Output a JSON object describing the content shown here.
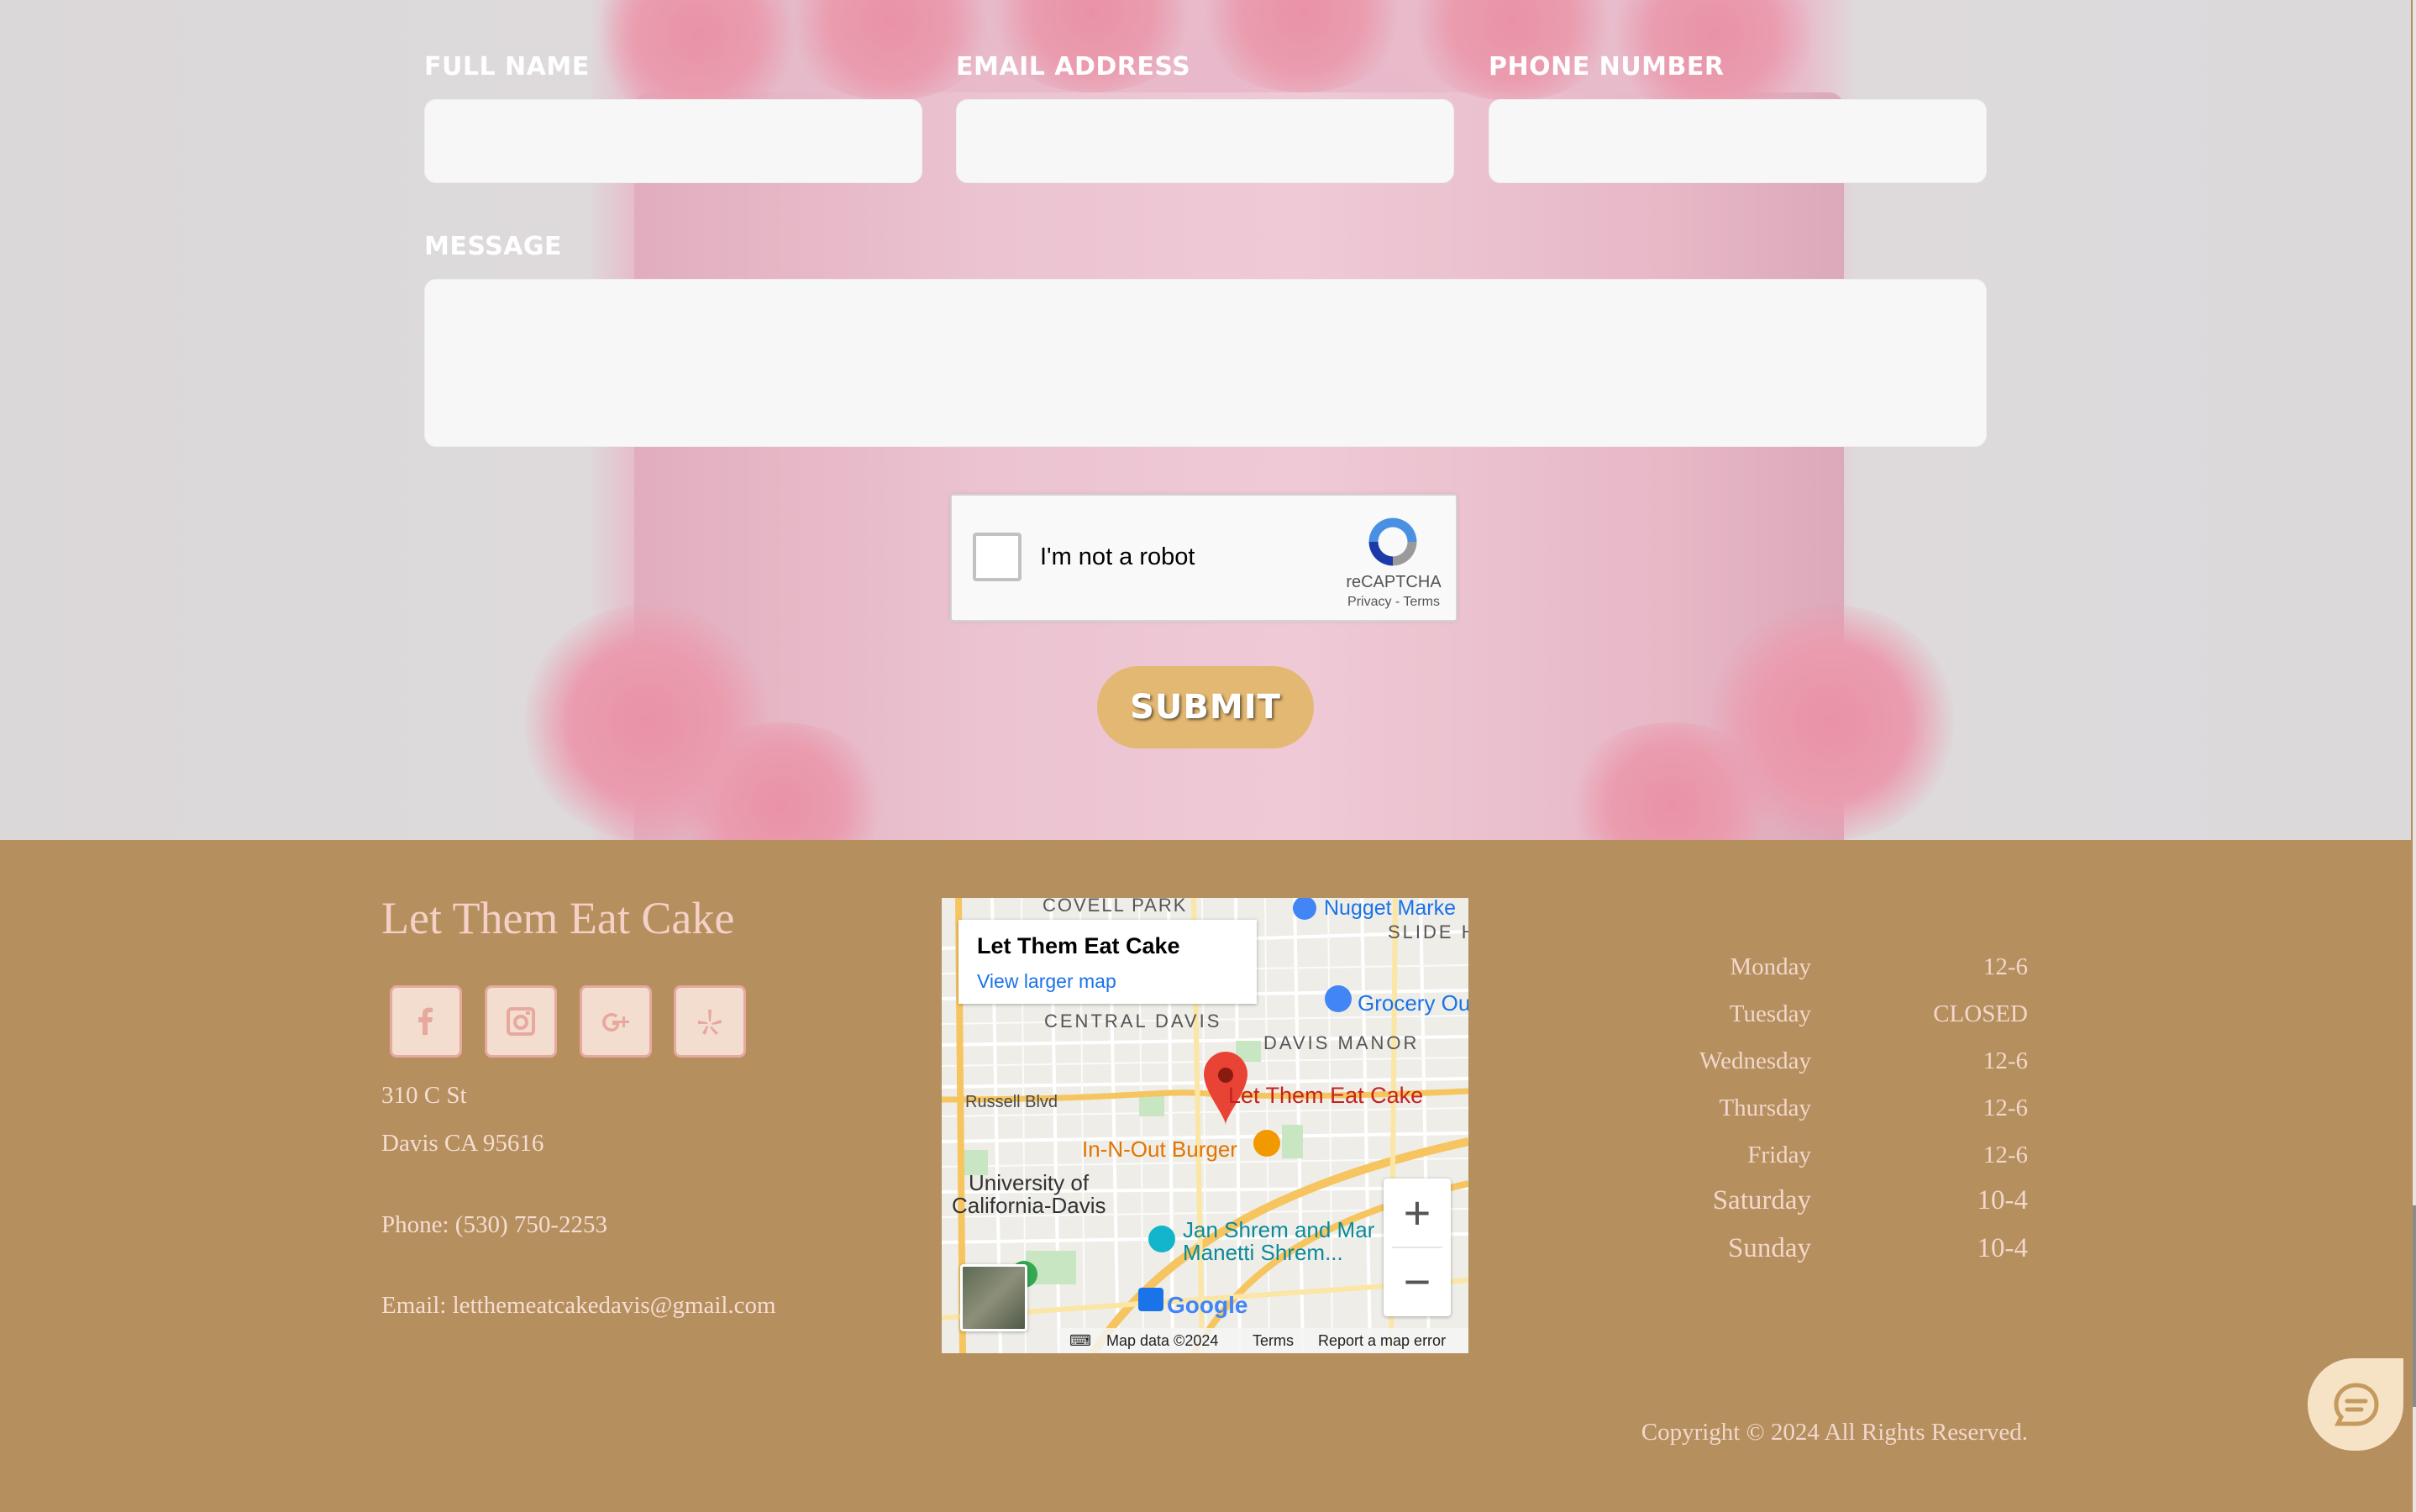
{
  "form": {
    "full_name_label": "FULL NAME",
    "email_label": "EMAIL ADDRESS",
    "phone_label": "PHONE NUMBER",
    "message_label": "MESSAGE",
    "full_name_value": "",
    "email_value": "",
    "phone_value": "",
    "message_value": "",
    "recaptcha_label": "I'm not a robot",
    "recaptcha_brand": "reCAPTCHA",
    "recaptcha_privacy": "Privacy",
    "recaptcha_terms": "Terms",
    "submit_label": "SUBMIT"
  },
  "footer": {
    "brand": "Let Them Eat Cake",
    "social_icons": [
      "facebook-icon",
      "instagram-icon",
      "google-plus-icon",
      "yelp-icon"
    ],
    "address_line1": "310 C St",
    "address_line2": "Davis CA 95616",
    "phone": "Phone: (530) 750-2253",
    "email_prefix": "Email: ",
    "email": "letthemeatcakedavis@gmail.com",
    "copyright": "Copyright © 2024 All Rights Reserved."
  },
  "map": {
    "card_title": "Let Them Eat Cake",
    "card_link": "View larger map",
    "labels": {
      "coveli_park": "COVELL PARK",
      "nugget": "Nugget Marke",
      "slide_hill": "SLIDE H",
      "central_davis": "CENTRAL DAVIS",
      "grocery": "Grocery Ou",
      "davis_manor": "DAVIS MANOR",
      "russell": "Russell Blvd",
      "pin": "Let Them Eat Cake",
      "innout": "In-N-Out Burger",
      "uc1": "University of",
      "uc2": "California-Davis",
      "shrem1": "Jan Shrem and Mar",
      "shrem2": "Manetti Shrem...",
      "google": "Google"
    },
    "footer_data": "Map data ©2024",
    "footer_terms": "Terms",
    "footer_report": "Report a map error",
    "zoom_in": "+",
    "zoom_out": "−"
  },
  "hours": [
    {
      "day": "Monday",
      "time": "12-6"
    },
    {
      "day": "Tuesday",
      "time": "CLOSED"
    },
    {
      "day": "Wednesday",
      "time": "12-6"
    },
    {
      "day": "Thursday",
      "time": "12-6"
    },
    {
      "day": "Friday",
      "time": "12-6"
    },
    {
      "day": "Saturday",
      "time": "10-4"
    },
    {
      "day": "Sunday",
      "time": "10-4"
    }
  ],
  "colors": {
    "footer_bg": "#b58f5e",
    "submit_bg": "#e3b872",
    "brand_text": "#f4d0c6"
  }
}
